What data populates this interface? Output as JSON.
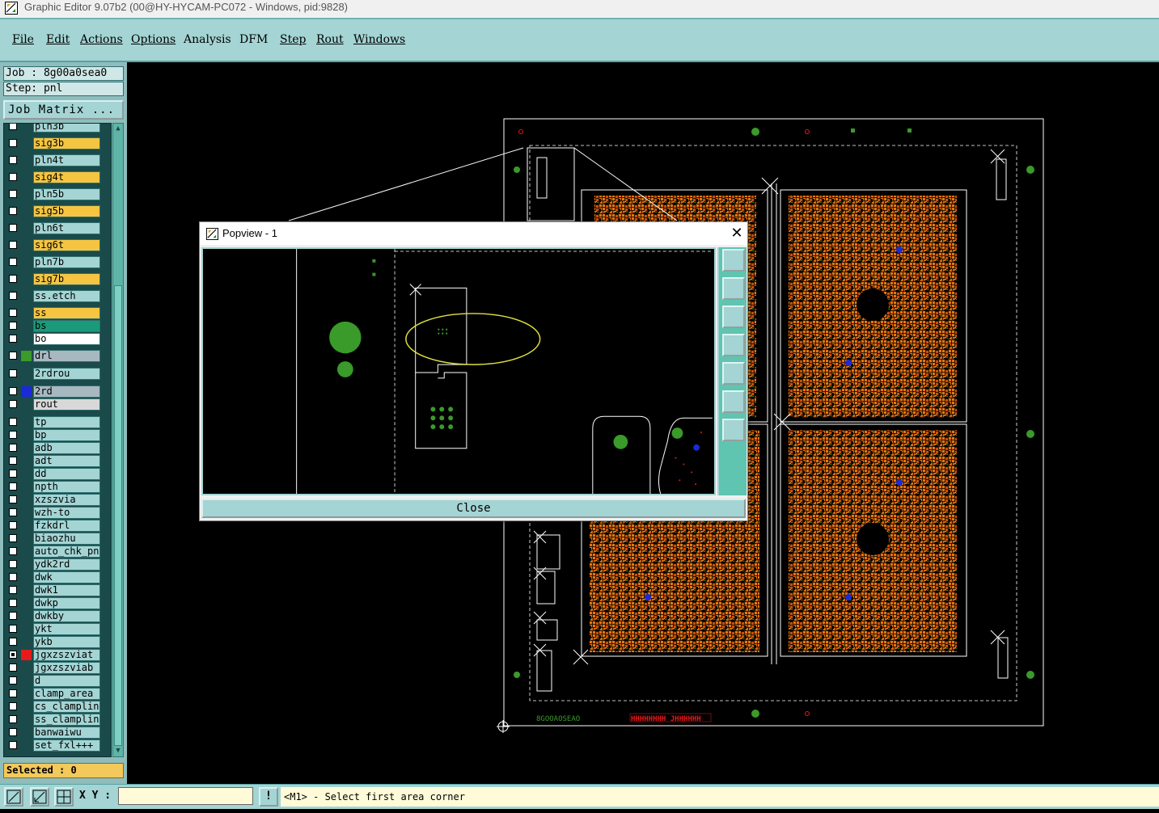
{
  "window": {
    "title": "Graphic Editor 9.07b2 (00@HY-HYCAM-PC072 - Windows, pid:9828)"
  },
  "menu": {
    "file": "File",
    "edit": "Edit",
    "actions": "Actions",
    "options": "Options",
    "analysis": "Analysis",
    "dfm": "DFM",
    "step": "Step",
    "rout": "Rout",
    "windows": "Windows"
  },
  "panel": {
    "job": "Job : 8g00a0sea0",
    "step": "Step: pnl",
    "job_matrix": "Job Matrix ...",
    "selected": "Selected : 0"
  },
  "layers": [
    {
      "name": "pln3b",
      "color": "#a4d4d4",
      "swatch": ""
    },
    {
      "name": "sig3b",
      "color": "#f5c542",
      "swatch": ""
    },
    {
      "name": "pln4t",
      "color": "#a4d4d4",
      "swatch": ""
    },
    {
      "name": "sig4t",
      "color": "#f5c542",
      "swatch": ""
    },
    {
      "name": "pln5b",
      "color": "#a4d4d4",
      "swatch": ""
    },
    {
      "name": "sig5b",
      "color": "#f5c542",
      "swatch": ""
    },
    {
      "name": "pln6t",
      "color": "#a4d4d4",
      "swatch": ""
    },
    {
      "name": "sig6t",
      "color": "#f5c542",
      "swatch": ""
    },
    {
      "name": "pln7b",
      "color": "#a4d4d4",
      "swatch": ""
    },
    {
      "name": "sig7b",
      "color": "#f5c542",
      "swatch": ""
    },
    {
      "name": "ss.etch",
      "color": "#a4d4d4",
      "swatch": ""
    },
    {
      "name": "ss",
      "color": "#f5c542",
      "swatch": ""
    },
    {
      "name": "bs",
      "color": "#1a9a7a",
      "swatch": ""
    },
    {
      "name": "bo",
      "color": "#ffffff",
      "swatch": ""
    },
    {
      "name": "drl",
      "color": "#a8b8c0",
      "swatch": "#3a9a2a"
    },
    {
      "name": "2rdrou",
      "color": "#a4d4d4",
      "swatch": ""
    },
    {
      "name": "2rd",
      "color": "#a8b8c0",
      "swatch": "#1a2ad8"
    },
    {
      "name": "rout",
      "color": "#d8d8d8",
      "swatch": ""
    },
    {
      "name": "tp",
      "color": "#a4d4d4",
      "swatch": ""
    },
    {
      "name": "bp",
      "color": "#a4d4d4",
      "swatch": ""
    },
    {
      "name": "adb",
      "color": "#a4d4d4",
      "swatch": ""
    },
    {
      "name": "adt",
      "color": "#a4d4d4",
      "swatch": ""
    },
    {
      "name": "dd",
      "color": "#a4d4d4",
      "swatch": ""
    },
    {
      "name": "npth",
      "color": "#a4d4d4",
      "swatch": ""
    },
    {
      "name": "xzszvia",
      "color": "#a4d4d4",
      "swatch": ""
    },
    {
      "name": "wzh-to",
      "color": "#a4d4d4",
      "swatch": ""
    },
    {
      "name": "fzkdrl",
      "color": "#a4d4d4",
      "swatch": ""
    },
    {
      "name": "biaozhu",
      "color": "#a4d4d4",
      "swatch": ""
    },
    {
      "name": "auto_chk_pnl",
      "color": "#a4d4d4",
      "swatch": ""
    },
    {
      "name": "ydk2rd",
      "color": "#a4d4d4",
      "swatch": ""
    },
    {
      "name": "dwk",
      "color": "#a4d4d4",
      "swatch": ""
    },
    {
      "name": "dwk1",
      "color": "#a4d4d4",
      "swatch": ""
    },
    {
      "name": "dwkp",
      "color": "#a4d4d4",
      "swatch": ""
    },
    {
      "name": "dwkby",
      "color": "#a4d4d4",
      "swatch": ""
    },
    {
      "name": "ykt",
      "color": "#a4d4d4",
      "swatch": ""
    },
    {
      "name": "ykb",
      "color": "#a4d4d4",
      "swatch": ""
    },
    {
      "name": "jgxzszviat",
      "color": "#a4d4d4",
      "swatch": "#e81a1a",
      "checked": true
    },
    {
      "name": "jgxzszviab",
      "color": "#a4d4d4",
      "swatch": ""
    },
    {
      "name": "d",
      "color": "#a4d4d4",
      "swatch": ""
    },
    {
      "name": "clamp_area",
      "color": "#a4d4d4",
      "swatch": ""
    },
    {
      "name": "cs_clampline",
      "color": "#a4d4d4",
      "swatch": ""
    },
    {
      "name": "ss_clampline",
      "color": "#a4d4d4",
      "swatch": ""
    },
    {
      "name": "banwaiwu",
      "color": "#a4d4d4",
      "swatch": ""
    },
    {
      "name": "set_fxl+++",
      "color": "#a4d4d4",
      "swatch": ""
    }
  ],
  "status": {
    "xy_label": "X Y :",
    "xy_value": "",
    "message": "<M1> - Select first area corner"
  },
  "popview": {
    "title": "Popview - 1",
    "close_label": "Close"
  },
  "board": {
    "code_left": "8GOOAOSEAO",
    "code_right": "HHHHHHHH JHHHHHH"
  }
}
